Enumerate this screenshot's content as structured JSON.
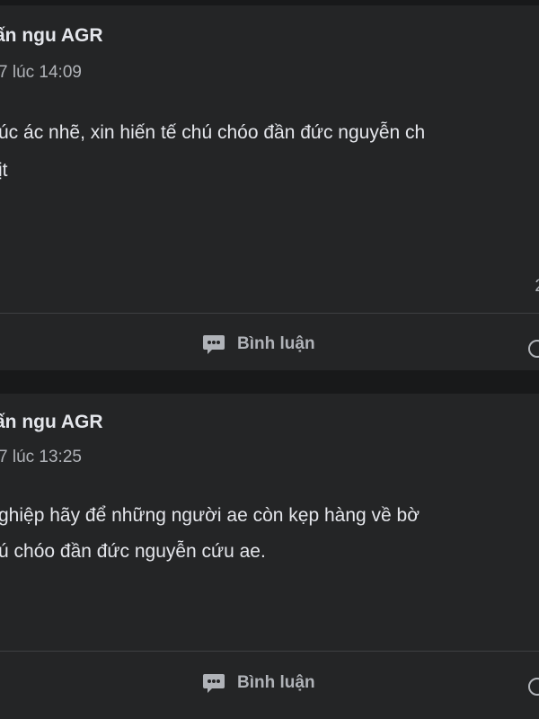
{
  "posts": [
    {
      "author": "ấn ngu AGR",
      "timestamp": "7 lúc 14:09",
      "body_lines": [
        "úc ác nhẽ, xin hiến tế chú chóo đần đức nguyễn ch",
        "ịt"
      ],
      "edge_text": "2",
      "comment_label": "Bình luận",
      "icons": {
        "comment": "comment-icon",
        "share": "share-icon"
      }
    },
    {
      "author": "ấn ngu AGR",
      "timestamp": "7 lúc 13:25",
      "body_lines": [
        "ghiệp hãy để những người ae còn kẹp hàng về bờ",
        "ú chóo đần đức nguyễn cứu ae."
      ],
      "comment_label": "Bình luận",
      "icons": {
        "comment": "comment-icon",
        "share": "share-icon"
      }
    }
  ],
  "colors": {
    "background": "#18191a",
    "card": "#242526",
    "primary_text": "#e4e6eb",
    "secondary_text": "#b0b3b8",
    "divider": "#3e4042"
  }
}
